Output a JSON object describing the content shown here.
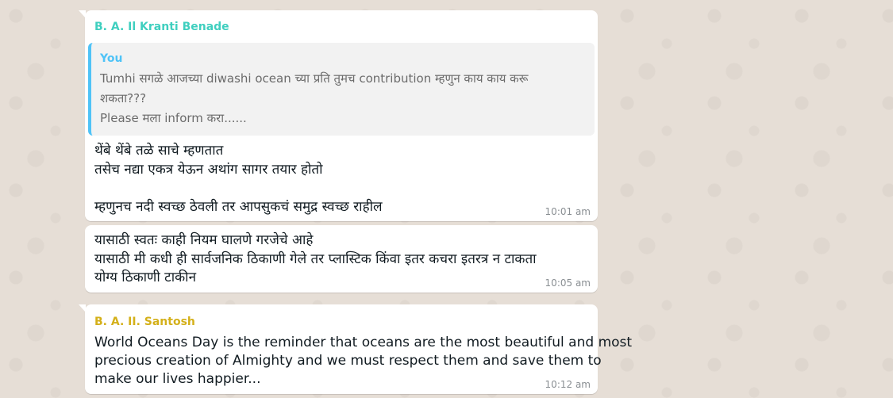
{
  "messages": [
    {
      "sender": "B. A. Il Kranti Benade",
      "sender_color": "#3fcfbf",
      "quote": {
        "author": "You",
        "lines": [
          "Tumhi सगळे आजच्या diwashi ocean च्या प्रति तुमच contribution म्हणुन काय काय करू",
          "शकता???",
          "Please मला inform करा......"
        ]
      },
      "lines": [
        "थेंबे थेंबे तळे साचे म्हणतात",
        " तसेच नद्या एकत्र येऊन अथांग सागर तयार होतो",
        "",
        "म्हणुनच नदी स्वच्छ ठेवली तर आपसुकचं समुद्र स्वच्छ राहील"
      ],
      "time": "10:01 am"
    },
    {
      "lines": [
        "यासाठी स्वतः काही नियम घालणे गरजेचे आहे",
        "यासाठी मी कधी ही सार्वजनिक ठिकाणी गेले तर प्लास्टिक किंवा इतर कचरा इतरत्र न टाकता",
        "योग्य ठिकाणी टाकीन"
      ],
      "time": "10:05 am"
    },
    {
      "sender": "B. A. II. Santosh",
      "sender_color": "#d4b01a",
      "lines": [
        "World Oceans Day is the reminder that oceans are the most beautiful and most",
        "precious creation of Almighty and we must respect them and save them to",
        "make our lives happier..."
      ],
      "time": "10:12 am"
    }
  ]
}
